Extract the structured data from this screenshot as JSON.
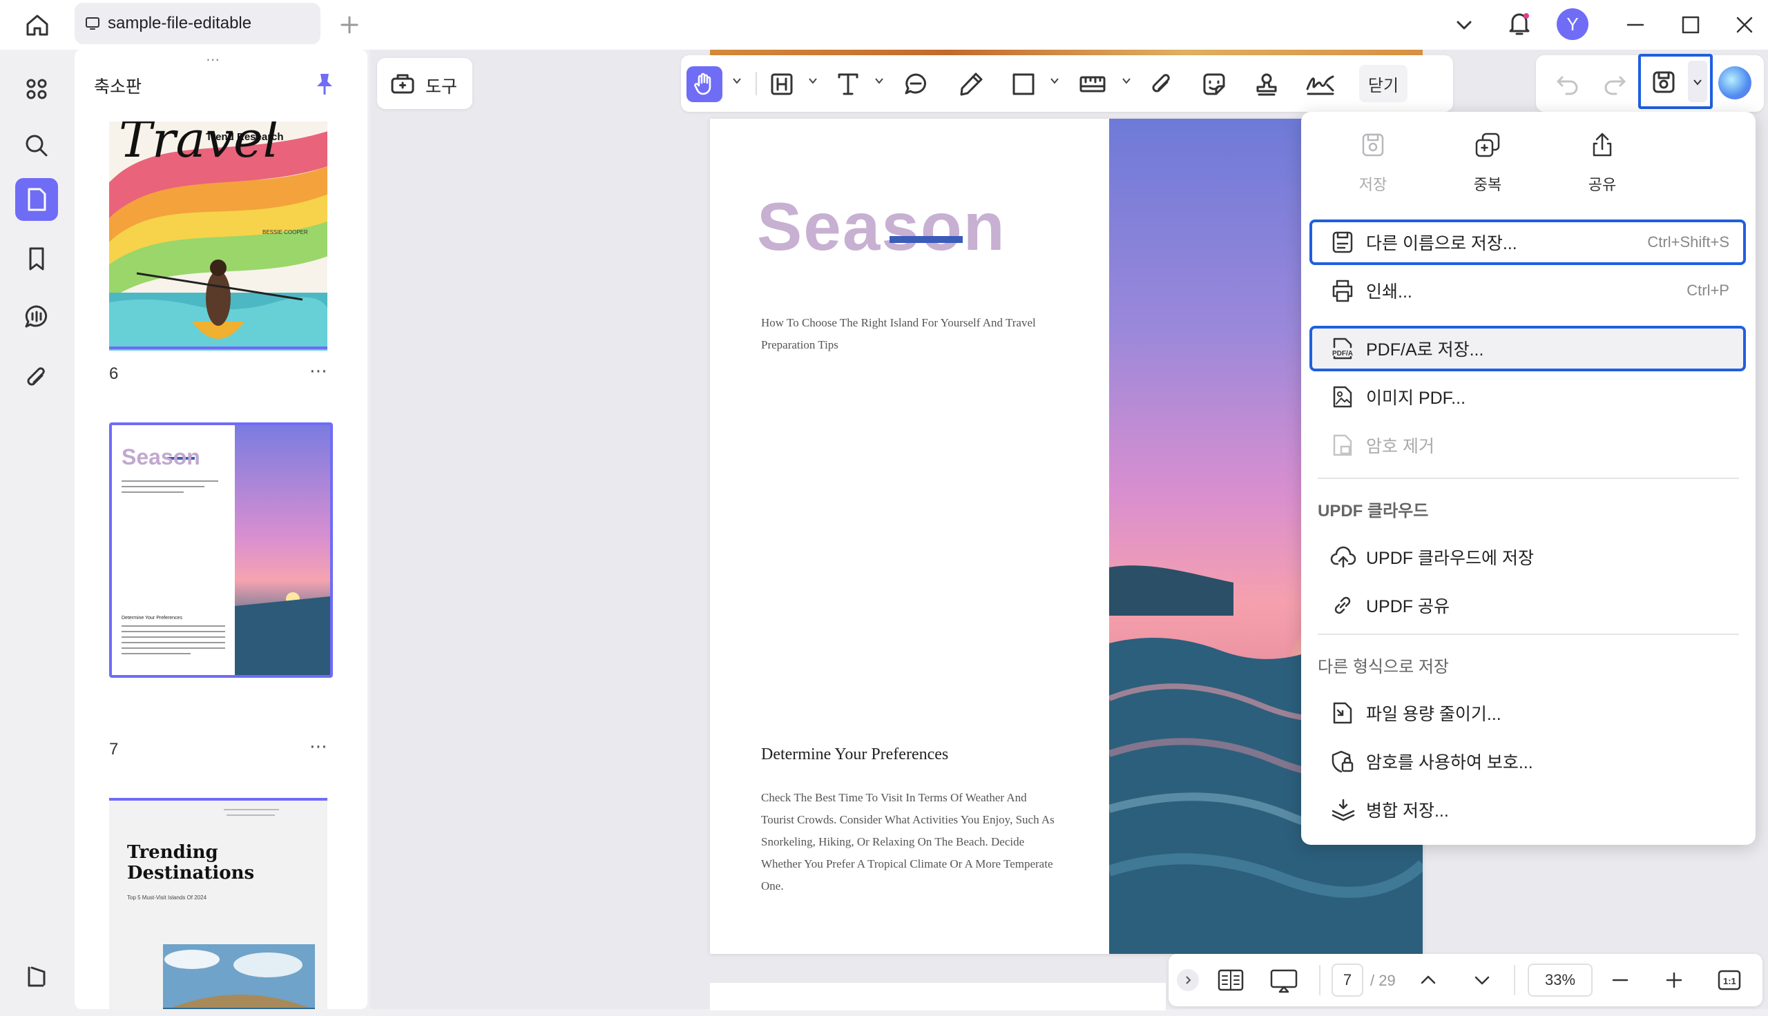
{
  "titlebar": {
    "tab_title": "sample-file-editable",
    "avatar_letter": "Y",
    "accent": "#6f6cf6"
  },
  "sidebar": {
    "panel_title": "축소판",
    "pages": [
      {
        "number": "6"
      },
      {
        "number": "7"
      }
    ]
  },
  "toolbar": {
    "tools_label": "도구",
    "close_label": "닫기"
  },
  "thumb6": {
    "title": "Travel",
    "subtitle": "Trend Research",
    "author": "BESSIE COOPER"
  },
  "thumb7": {
    "title": "Season",
    "heading": "Determine Your Preferences"
  },
  "thumb8": {
    "title": "Trending Destinations",
    "subtitle": "Top 5 Must-Visit Islands Of 2024"
  },
  "document": {
    "title": "Season",
    "subtitle": "How To Choose The Right Island For Yourself And Travel Preparation Tips",
    "heading": "Determine Your Preferences",
    "body": "Check The Best Time To Visit In Terms Of Weather And Tourist Crowds. Consider What Activities You Enjoy, Such As Snorkeling, Hiking, Or Relaxing On The Beach. Decide Whether You Prefer A Tropical Climate Or A More Temperate One."
  },
  "save_menu": {
    "top_actions": [
      {
        "label": "저장",
        "icon": "save-icon",
        "disabled": true
      },
      {
        "label": "중복",
        "icon": "duplicate-icon",
        "disabled": false
      },
      {
        "label": "공유",
        "icon": "share-icon",
        "disabled": false
      }
    ],
    "save_as": {
      "label": "다른 이름으로 저장...",
      "shortcut": "Ctrl+Shift+S"
    },
    "print": {
      "label": "인쇄...",
      "shortcut": "Ctrl+P"
    },
    "save_pdfa": {
      "label": "PDF/A로 저장..."
    },
    "image_pdf": {
      "label": "이미지 PDF..."
    },
    "remove_password": {
      "label": "암호 제거"
    },
    "cloud_section": "UPDF 클라우드",
    "cloud_save": {
      "label": "UPDF 클라우드에 저장"
    },
    "cloud_share": {
      "label": "UPDF 공유"
    },
    "other_section": "다른 형식으로 저장",
    "reduce_size": {
      "label": "파일 용량 줄이기..."
    },
    "protect": {
      "label": "암호를 사용하여 보호..."
    },
    "flatten": {
      "label": "병합 저장..."
    }
  },
  "bottombar": {
    "current_page": "7",
    "total_pages": "/ 29",
    "zoom": "33%"
  }
}
